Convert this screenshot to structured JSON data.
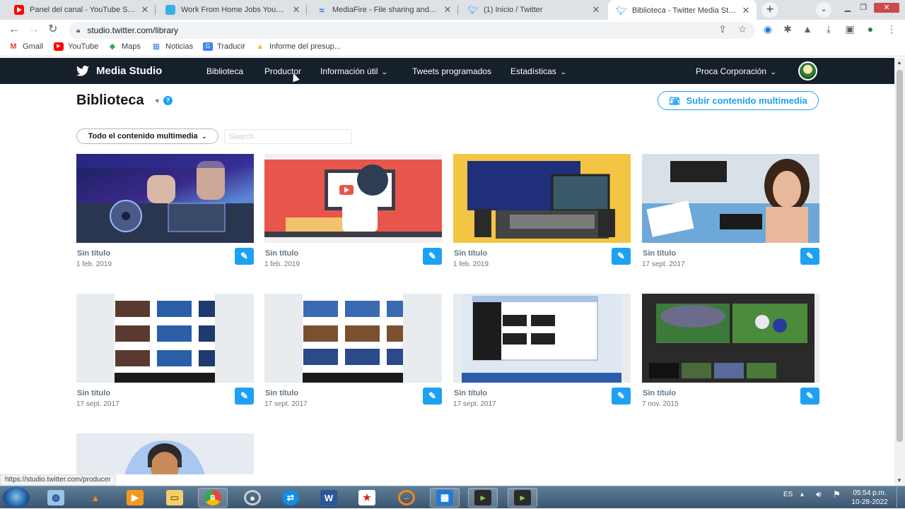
{
  "browser": {
    "tabs": [
      {
        "title": "Panel del canal - YouTube Studio",
        "icon": "youtube-favicon",
        "color": "#ff0000"
      },
      {
        "title": "Work From Home Jobs YouTube",
        "icon": "page-favicon",
        "color": "#36b0e0"
      },
      {
        "title": "MediaFire - File sharing and stora",
        "icon": "mediafire-favicon",
        "color": "#1a73e8"
      },
      {
        "title": "(1) Inicio / Twitter",
        "icon": "twitter-favicon",
        "color": "#1da1f2"
      },
      {
        "title": "Biblioteca - Twitter Media Studio",
        "icon": "twitter-favicon",
        "color": "#1da1f2"
      }
    ],
    "new_tab": "+",
    "url": "studio.twitter.com/library",
    "bookmarks": [
      {
        "label": "Gmail",
        "icon": "gmail-icon"
      },
      {
        "label": "YouTube",
        "icon": "youtube-icon"
      },
      {
        "label": "Maps",
        "icon": "maps-icon"
      },
      {
        "label": "Noticias",
        "icon": "news-icon"
      },
      {
        "label": "Traducir",
        "icon": "translate-icon"
      },
      {
        "label": "Informe del presup...",
        "icon": "drive-icon"
      }
    ],
    "status_url": "https://studio.twitter.com/producer"
  },
  "app": {
    "brand": "Media Studio",
    "nav": [
      {
        "label": "Biblioteca",
        "dropdown": false
      },
      {
        "label": "Productor",
        "dropdown": false
      },
      {
        "label": "Información útil",
        "dropdown": true
      },
      {
        "label": "Tweets programados",
        "dropdown": false
      },
      {
        "label": "Estadísticas",
        "dropdown": true
      }
    ],
    "account": "Proca Corporación",
    "accent": "#1da1f2",
    "navbar_color": "#15202b"
  },
  "page": {
    "title": "Biblioteca",
    "help": "?",
    "upload_label": "Subir contenido multimedia",
    "filter_label": "Todo el contenido multimedia",
    "search_placeholder": "Search"
  },
  "media": [
    {
      "title": "Sin título",
      "date": "1 feb. 2019",
      "thumb": "dj-mixer"
    },
    {
      "title": "Sin título",
      "date": "1 feb. 2019",
      "thumb": "youtube-illustration"
    },
    {
      "title": "Sin título",
      "date": "1 feb. 2019",
      "thumb": "radio-studio"
    },
    {
      "title": "Sin título",
      "date": "17 sept. 2017",
      "thumb": "radio-host"
    },
    {
      "title": "Sin título",
      "date": "17 sept. 2017",
      "thumb": "virtual-sets-grid"
    },
    {
      "title": "Sin título",
      "date": "17 sept. 2017",
      "thumb": "virtual-sets-grid-2"
    },
    {
      "title": "Sin título",
      "date": "17 sept. 2017",
      "thumb": "desktop-screenshot"
    },
    {
      "title": "Sin título",
      "date": "7 nov. 2015",
      "thumb": "football-broadcast"
    },
    {
      "title": "",
      "date": "",
      "thumb": "cartoon-character"
    }
  ],
  "taskbar": {
    "language": "ES",
    "time": "05:54 p.m.",
    "date": "10-28-2022"
  }
}
